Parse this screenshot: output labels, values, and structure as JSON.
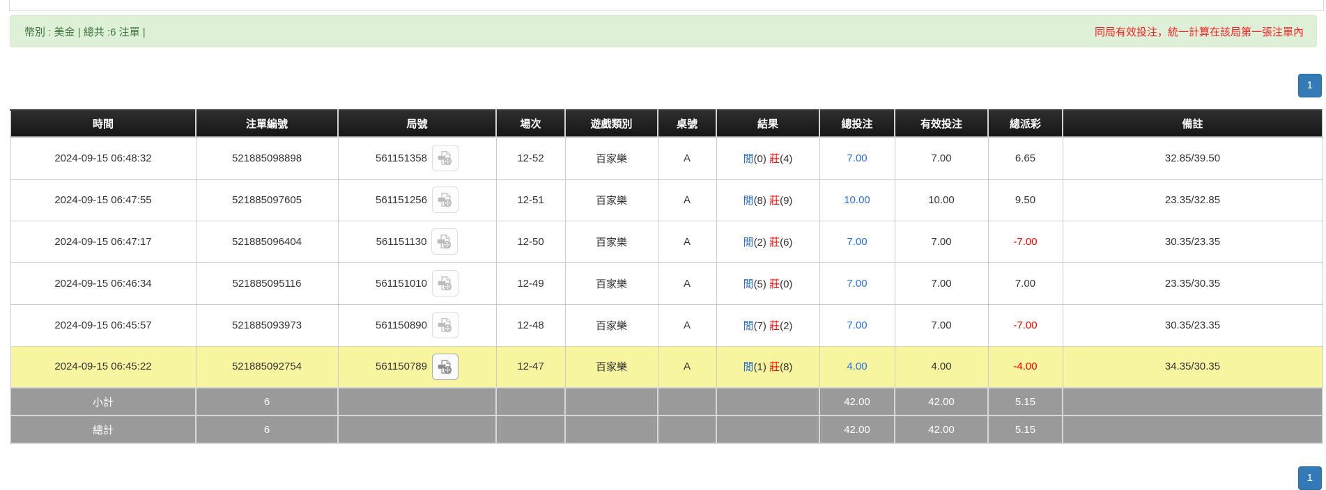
{
  "banner": {
    "left": "幣別 : 美金 | 總共 :6 注單 |",
    "right": "同局有效投注，統一計算在該局第一張注單內"
  },
  "pagination": {
    "page": "1"
  },
  "table": {
    "headers": [
      "時間",
      "注單編號",
      "局號",
      "場次",
      "遊戲類別",
      "桌號",
      "結果",
      "總投注",
      "有效投注",
      "總派彩",
      "備註"
    ],
    "rows": [
      {
        "time": "2024-09-15 06:48:32",
        "bet_id": "521885098898",
        "round_id": "561151358",
        "session": "12-52",
        "game": "百家樂",
        "table_code": "A",
        "res_p_label": "閒",
        "res_p_num": "(0)",
        "res_b_label": "莊",
        "res_b_num": "(4)",
        "total_bet": "7.00",
        "valid_bet": "7.00",
        "payout": "6.65",
        "remark": "32.85/39.50"
      },
      {
        "time": "2024-09-15 06:47:55",
        "bet_id": "521885097605",
        "round_id": "561151256",
        "session": "12-51",
        "game": "百家樂",
        "table_code": "A",
        "res_p_label": "閒",
        "res_p_num": "(8)",
        "res_b_label": "莊",
        "res_b_num": "(9)",
        "total_bet": "10.00",
        "valid_bet": "10.00",
        "payout": "9.50",
        "remark": "23.35/32.85"
      },
      {
        "time": "2024-09-15 06:47:17",
        "bet_id": "521885096404",
        "round_id": "561151130",
        "session": "12-50",
        "game": "百家樂",
        "table_code": "A",
        "res_p_label": "閒",
        "res_p_num": "(2)",
        "res_b_label": "莊",
        "res_b_num": "(6)",
        "total_bet": "7.00",
        "valid_bet": "7.00",
        "payout": "-7.00",
        "remark": "30.35/23.35"
      },
      {
        "time": "2024-09-15 06:46:34",
        "bet_id": "521885095116",
        "round_id": "561151010",
        "session": "12-49",
        "game": "百家樂",
        "table_code": "A",
        "res_p_label": "閒",
        "res_p_num": "(5)",
        "res_b_label": "莊",
        "res_b_num": "(0)",
        "total_bet": "7.00",
        "valid_bet": "7.00",
        "payout": "7.00",
        "remark": "23.35/30.35"
      },
      {
        "time": "2024-09-15 06:45:57",
        "bet_id": "521885093973",
        "round_id": "561150890",
        "session": "12-48",
        "game": "百家樂",
        "table_code": "A",
        "res_p_label": "閒",
        "res_p_num": "(7)",
        "res_b_label": "莊",
        "res_b_num": "(2)",
        "total_bet": "7.00",
        "valid_bet": "7.00",
        "payout": "-7.00",
        "remark": "30.35/23.35"
      },
      {
        "time": "2024-09-15 06:45:22",
        "bet_id": "521885092754",
        "round_id": "561150789",
        "session": "12-47",
        "game": "百家樂",
        "table_code": "A",
        "res_p_label": "閒",
        "res_p_num": "(1)",
        "res_b_label": "莊",
        "res_b_num": "(8)",
        "total_bet": "4.00",
        "valid_bet": "4.00",
        "payout": "-4.00",
        "remark": "34.35/30.35"
      }
    ],
    "subtotal": {
      "label": "小計",
      "count": "6",
      "total_bet": "42.00",
      "valid_bet": "42.00",
      "payout": "5.15"
    },
    "total": {
      "label": "總計",
      "count": "6",
      "total_bet": "42.00",
      "valid_bet": "42.00",
      "payout": "5.15"
    }
  },
  "icons": {
    "video_replay": "video-file-icon"
  },
  "colors": {
    "banner_bg": "#dff0d8",
    "banner_text": "#3c763d",
    "banner_note_red": "#ff1f1f",
    "header_bg": "#1b1b1b",
    "highlight_yellow": "#f8f5a0",
    "summary_gray": "#9a9a9a",
    "link_blue": "#2a6edd",
    "negative_red": "#ff0000",
    "pager_blue": "#337ab7"
  }
}
